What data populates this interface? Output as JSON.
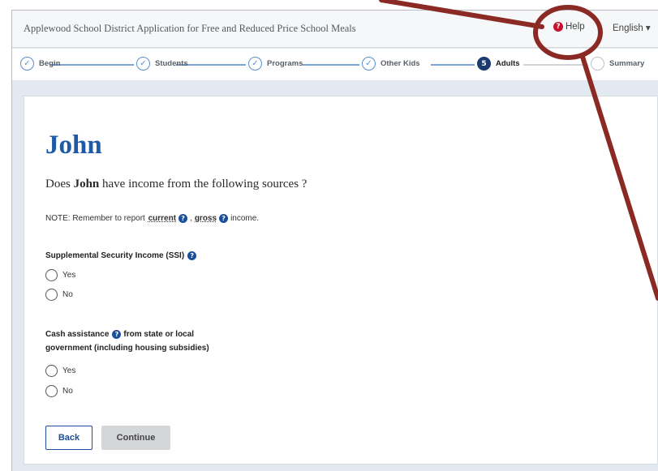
{
  "header": {
    "app_title": "Applewood School District Application for Free and Reduced Price School Meals",
    "help_label": "Help",
    "help_icon": "?",
    "language_label": "English ▾"
  },
  "steps": [
    {
      "label": "Begin",
      "state": "done",
      "marker": "✓"
    },
    {
      "label": "Students",
      "state": "done",
      "marker": "✓"
    },
    {
      "label": "Programs",
      "state": "done",
      "marker": "✓"
    },
    {
      "label": "Other Kids",
      "state": "done",
      "marker": "✓"
    },
    {
      "label": "Adults",
      "state": "active",
      "marker": "5"
    },
    {
      "label": "Summary",
      "state": "todo",
      "marker": ""
    }
  ],
  "main": {
    "person_name": "John",
    "question_prefix": "Does ",
    "question_name": "John",
    "question_suffix": " have income from the following sources ?",
    "note_prefix": "NOTE: Remember to report ",
    "note_term_current": "current",
    "note_separator": ",",
    "note_term_gross": "gross",
    "note_suffix": "income.",
    "info_icon_glyph": "?",
    "sections": [
      {
        "label": "Supplemental Security Income (SSI)",
        "options": [
          "Yes",
          "No"
        ]
      },
      {
        "label_part1": "Cash assistance",
        "label_part2": "from state or local",
        "label_part3": "government (including housing subsidies)",
        "options": [
          "Yes",
          "No"
        ]
      }
    ],
    "back_label": "Back",
    "continue_label": "Continue"
  },
  "colors": {
    "accent_blue": "#1f5aa8",
    "help_red": "#c8102e",
    "annotation": "#8b2a25"
  }
}
